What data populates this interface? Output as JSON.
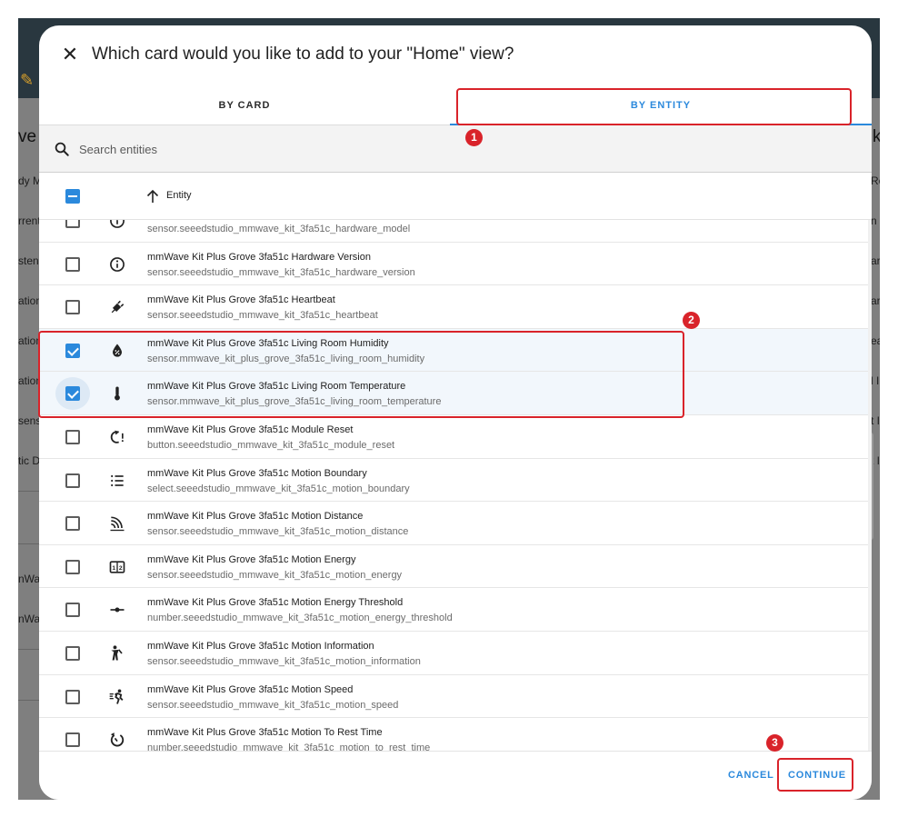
{
  "background": {
    "heading_left": "ve",
    "heading_right": "k",
    "left_texts": [
      "dy M",
      "rrent",
      "sten",
      "ation",
      "ation",
      "ation",
      "sens",
      "tic D",
      "nWa",
      "nWa"
    ],
    "right_texts": [
      "Re",
      "n I",
      "ar",
      "ar",
      "ea",
      "l In",
      "t I",
      "t I"
    ]
  },
  "dialog": {
    "title": "Which card would you like to add to your \"Home\" view?",
    "close_icon": "close-icon",
    "tabs": [
      {
        "label": "BY CARD",
        "active": false
      },
      {
        "label": "BY ENTITY",
        "active": true
      }
    ],
    "search": {
      "placeholder": "Search entities",
      "value": ""
    },
    "table": {
      "column_header": "Entity",
      "sort_direction": "ascending"
    },
    "rows": [
      {
        "name": "",
        "entity_id": "sensor.seeedstudio_mmwave_kit_3fa51c_hardware_model",
        "icon": "info-icon",
        "selected": false
      },
      {
        "name": "mmWave Kit Plus Grove 3fa51c Hardware Version",
        "entity_id": "sensor.seeedstudio_mmwave_kit_3fa51c_hardware_version",
        "icon": "info-icon",
        "selected": false
      },
      {
        "name": "mmWave Kit Plus Grove 3fa51c Heartbeat",
        "entity_id": "sensor.seeedstudio_mmwave_kit_3fa51c_heartbeat",
        "icon": "plug-icon",
        "selected": false
      },
      {
        "name": "mmWave Kit Plus Grove 3fa51c Living Room Humidity",
        "entity_id": "sensor.mmwave_kit_plus_grove_3fa51c_living_room_humidity",
        "icon": "humidity-icon",
        "selected": true
      },
      {
        "name": "mmWave Kit Plus Grove 3fa51c Living Room Temperature",
        "entity_id": "sensor.mmwave_kit_plus_grove_3fa51c_living_room_temperature",
        "icon": "thermometer-icon",
        "selected": true
      },
      {
        "name": "mmWave Kit Plus Grove 3fa51c Module Reset",
        "entity_id": "button.seeedstudio_mmwave_kit_3fa51c_module_reset",
        "icon": "restart-alert-icon",
        "selected": false
      },
      {
        "name": "mmWave Kit Plus Grove 3fa51c Motion Boundary",
        "entity_id": "select.seeedstudio_mmwave_kit_3fa51c_motion_boundary",
        "icon": "format-list-icon",
        "selected": false
      },
      {
        "name": "mmWave Kit Plus Grove 3fa51c Motion Distance",
        "entity_id": "sensor.seeedstudio_mmwave_kit_3fa51c_motion_distance",
        "icon": "signal-distance-icon",
        "selected": false
      },
      {
        "name": "mmWave Kit Plus Grove 3fa51c Motion Energy",
        "entity_id": "sensor.seeedstudio_mmwave_kit_3fa51c_motion_energy",
        "icon": "counter-icon",
        "selected": false
      },
      {
        "name": "mmWave Kit Plus Grove 3fa51c Motion Energy Threshold",
        "entity_id": "number.seeedstudio_mmwave_kit_3fa51c_motion_energy_threshold",
        "icon": "slider-icon",
        "selected": false
      },
      {
        "name": "mmWave Kit Plus Grove 3fa51c Motion Information",
        "entity_id": "sensor.seeedstudio_mmwave_kit_3fa51c_motion_information",
        "icon": "human-icon",
        "selected": false
      },
      {
        "name": "mmWave Kit Plus Grove 3fa51c Motion Speed",
        "entity_id": "sensor.seeedstudio_mmwave_kit_3fa51c_motion_speed",
        "icon": "run-fast-icon",
        "selected": false
      },
      {
        "name": "mmWave Kit Plus Grove 3fa51c Motion To Rest Time",
        "entity_id": "number.seeedstudio_mmwave_kit_3fa51c_motion_to_rest_time",
        "icon": "timer-icon",
        "selected": false
      }
    ],
    "buttons": {
      "cancel": "CANCEL",
      "continue": "CONTINUE"
    }
  },
  "annotations": {
    "badges": [
      "1",
      "2",
      "3"
    ],
    "color": "#d9232a"
  },
  "colors": {
    "accent": "#2b89dc",
    "selected_row": "#f2f7fc",
    "topbar": "#29373f"
  }
}
